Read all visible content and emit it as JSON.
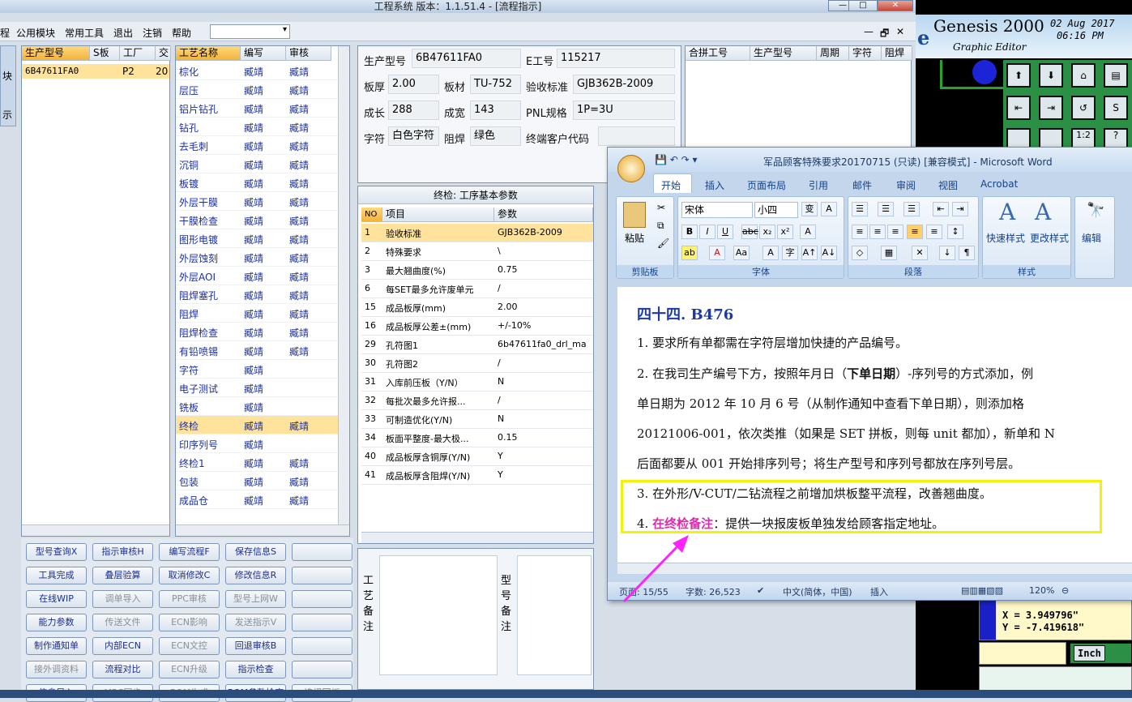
{
  "app": {
    "title": "工程系统   版本：1.1.51.4 - [流程指示]",
    "window_controls": [
      "—",
      "□",
      "✕"
    ]
  },
  "menu": {
    "items": [
      "程",
      "公用模块",
      "常用工具",
      "退出",
      "注销",
      "帮助"
    ],
    "combo_value": "",
    "mdi_controls": [
      "—",
      "🗗",
      "✕"
    ]
  },
  "left_tab": {
    "labels": [
      "块",
      "示"
    ]
  },
  "model_list": {
    "headers": [
      "生产型号",
      "S板",
      "工厂",
      "交"
    ],
    "rows": [
      [
        "6B47611FA0",
        "",
        "P2",
        "20"
      ]
    ]
  },
  "process_list": {
    "headers": [
      "工艺名称",
      "编写",
      "审核"
    ],
    "rows": [
      [
        "棕化",
        "臧靖",
        "臧靖"
      ],
      [
        "层压",
        "臧靖",
        "臧靖"
      ],
      [
        "铝片钻孔",
        "臧靖",
        "臧靖"
      ],
      [
        "钻孔",
        "臧靖",
        "臧靖"
      ],
      [
        "去毛刺",
        "臧靖",
        "臧靖"
      ],
      [
        "沉铜",
        "臧靖",
        "臧靖"
      ],
      [
        "板镀",
        "臧靖",
        "臧靖"
      ],
      [
        "外层干膜",
        "臧靖",
        "臧靖"
      ],
      [
        "干膜检查",
        "臧靖",
        "臧靖"
      ],
      [
        "图形电镀",
        "臧靖",
        "臧靖"
      ],
      [
        "外层蚀刻",
        "臧靖",
        "臧靖"
      ],
      [
        "外层AOI",
        "臧靖",
        "臧靖"
      ],
      [
        "阻焊塞孔",
        "臧靖",
        "臧靖"
      ],
      [
        "阻焊",
        "臧靖",
        "臧靖"
      ],
      [
        "阻焊检查",
        "臧靖",
        "臧靖"
      ],
      [
        "有铅喷锡",
        "臧靖",
        "臧靖"
      ],
      [
        "字符",
        "臧靖",
        ""
      ],
      [
        "电子测试",
        "臧靖",
        ""
      ],
      [
        "铣板",
        "臧靖",
        ""
      ],
      [
        "终检",
        "臧靖",
        "臧靖"
      ],
      [
        "印序列号",
        "臧靖",
        ""
      ],
      [
        "终检1",
        "臧靖",
        "臧靖"
      ],
      [
        "包装",
        "臧靖",
        "臧靖"
      ],
      [
        "成品仓",
        "臧靖",
        "臧靖"
      ]
    ],
    "selected_index": 19
  },
  "info": {
    "model_label": "生产型号",
    "model_value": "6B47611FA0",
    "e_label": "E工号",
    "e_value": "115217",
    "thickness_label": "板厚",
    "thickness_value": "2.00",
    "material_label": "板材",
    "material_value": "TU-752",
    "standard_label": "验收标准",
    "standard_value": "GJB362B-2009",
    "length_label": "成长",
    "length_value": "288",
    "width_label": "成宽",
    "width_value": "143",
    "pnl_label": "PNL规格",
    "pnl_value": "1P=3U",
    "char_label": "字符",
    "char_value": "白色字符",
    "solder_label": "阻焊",
    "solder_value": "绿色",
    "customer_label": "终端客户代码",
    "customer_value": ""
  },
  "merge_table": {
    "headers": [
      "合拼工号",
      "生产型号",
      "周期",
      "字符",
      "阻焊"
    ]
  },
  "params": {
    "title": "终检: 工序基本参数",
    "headers": [
      "NO",
      "项目",
      "参数"
    ],
    "rows": [
      [
        "1",
        "验收标准",
        "GJB362B-2009"
      ],
      [
        "2",
        "特殊要求",
        "\\"
      ],
      [
        "3",
        "最大翘曲度(%)",
        "0.75"
      ],
      [
        "6",
        "每SET最多允许废单元",
        "/"
      ],
      [
        "15",
        "成品板厚(mm)",
        "2.00"
      ],
      [
        "16",
        "成品板厚公差±(mm)",
        "+/-10%"
      ],
      [
        "29",
        "孔符图1",
        "6b47611fa0_drl_ma"
      ],
      [
        "30",
        "孔符图2",
        "/"
      ],
      [
        "31",
        "入库前压板（Y/N）",
        "N"
      ],
      [
        "32",
        "每批次最多允许报...",
        "/"
      ],
      [
        "33",
        "可制造优化(Y/N)",
        "N"
      ],
      [
        "34",
        "板面平整度-最大极...",
        "0.15"
      ],
      [
        "40",
        "成品板厚含铜厚(Y/N)",
        "Y"
      ],
      [
        "41",
        "成品板厚含阻焊(Y/N)",
        "Y"
      ]
    ]
  },
  "remarks": {
    "process_label": "工艺备注",
    "model_label": "型号备注"
  },
  "buttons": [
    [
      "型号查询X",
      "指示审核H",
      "编写流程F",
      "保存信息S",
      ""
    ],
    [
      "工具完成",
      "叠层验算",
      "取消修改C",
      "修改信息R",
      ""
    ],
    [
      "在线WIP",
      "调单导入",
      "PPC审核",
      "型号上网W",
      ""
    ],
    [
      "能力参数",
      "传送文件",
      "ECN影响",
      "发送指示V",
      ""
    ],
    [
      "制作通知单",
      "内部ECN",
      "ECN文控",
      "回退审核B",
      ""
    ],
    [
      "接外调资料",
      "流程对比",
      "ECN升级",
      "指示检查",
      ""
    ],
    [
      "信息导入",
      "MRS同步",
      "BOM生成",
      "BOM参数检查",
      "选择回板"
    ]
  ],
  "disabled_buttons": [
    "调单导入",
    "PPC审核",
    "型号上网W",
    "传送文件",
    "ECN影响",
    "发送指示V",
    "ECN文控",
    "接外调资料",
    "ECN升级",
    "MRS同步",
    "BOM生成",
    "选择回板"
  ],
  "genesis": {
    "title": "Genesis 2000",
    "subtitle": "Graphic Editor",
    "date": "02 Aug 2017",
    "time": "06:16 PM",
    "x_readout": "X =  3.949796\"",
    "y_readout": "Y = -7.419618\"",
    "unit_button": "Inch"
  },
  "word": {
    "title": "军品顾客特殊要求20170715 (只读) [兼容模式] - Microsoft Word",
    "tabs": [
      "开始",
      "插入",
      "页面布局",
      "引用",
      "邮件",
      "审阅",
      "视图",
      "Acrobat"
    ],
    "font_name": "宋体",
    "font_size": "小四",
    "group_labels": [
      "剪贴板",
      "字体",
      "段落",
      "样式",
      "编辑"
    ],
    "paste_label": "粘贴",
    "quick_style": "快速样式",
    "change_style": "更改样式",
    "edit_label": "编辑",
    "heading": "四十四. B476",
    "lines": [
      "1. 要求所有单都需在字符层增加快捷的产品编号。",
      "2. 在我司生产编号下方，按照年月日（",
      "下单日期",
      "）-序列号的方式添加，例",
      "单日期为 2012 年 10 月 6 号（从制作通知中查看下单日期），则添加格",
      "20121006-001，依次类推（如果是 SET 拼板，则每 unit 都加），新单和 N",
      "后面都要从 001 开始排序列号；将生产型号和序列号都放在序列号层。",
      "3. 在外形/V-CUT/二钻流程之前增加烘板整平流程，改善翘曲度。",
      "4. ",
      "在终检备注",
      "：提供一块报废板单独发给顾客指定地址。"
    ],
    "status_page": "页面: 15/55",
    "status_words": "字数: 26,523",
    "status_lang": "中文(简体，中国)",
    "status_mode": "插入",
    "status_zoom": "120%"
  },
  "colors": {
    "highlight": "#ffe29b",
    "annotation": "#ff22ff",
    "box": "#f2f20a",
    "heading": "#1f3a9e"
  }
}
